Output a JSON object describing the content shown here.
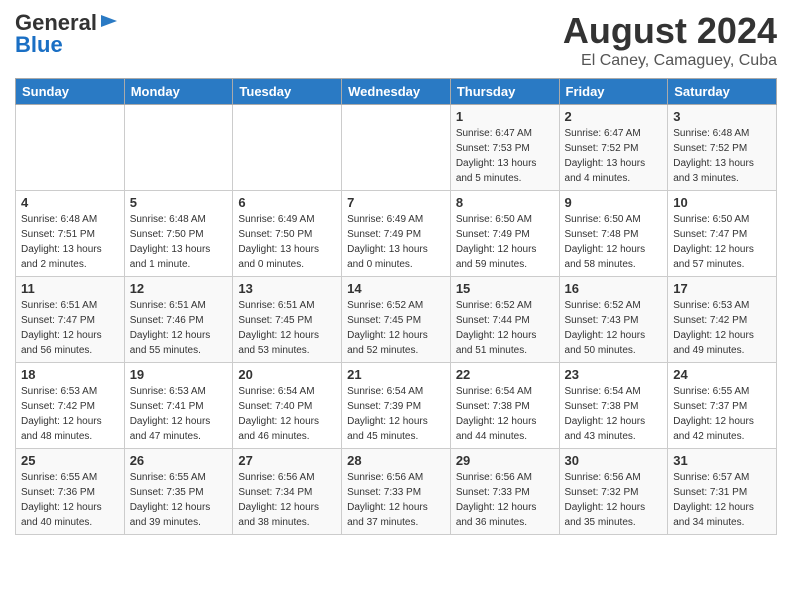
{
  "header": {
    "logo_line1": "General",
    "logo_line2": "Blue",
    "month_year": "August 2024",
    "location": "El Caney, Camaguey, Cuba"
  },
  "days_of_week": [
    "Sunday",
    "Monday",
    "Tuesday",
    "Wednesday",
    "Thursday",
    "Friday",
    "Saturday"
  ],
  "weeks": [
    [
      {
        "day": "",
        "sunrise": "",
        "sunset": "",
        "daylight": ""
      },
      {
        "day": "",
        "sunrise": "",
        "sunset": "",
        "daylight": ""
      },
      {
        "day": "",
        "sunrise": "",
        "sunset": "",
        "daylight": ""
      },
      {
        "day": "",
        "sunrise": "",
        "sunset": "",
        "daylight": ""
      },
      {
        "day": "1",
        "sunrise": "Sunrise: 6:47 AM",
        "sunset": "Sunset: 7:53 PM",
        "daylight": "Daylight: 13 hours and 5 minutes."
      },
      {
        "day": "2",
        "sunrise": "Sunrise: 6:47 AM",
        "sunset": "Sunset: 7:52 PM",
        "daylight": "Daylight: 13 hours and 4 minutes."
      },
      {
        "day": "3",
        "sunrise": "Sunrise: 6:48 AM",
        "sunset": "Sunset: 7:52 PM",
        "daylight": "Daylight: 13 hours and 3 minutes."
      }
    ],
    [
      {
        "day": "4",
        "sunrise": "Sunrise: 6:48 AM",
        "sunset": "Sunset: 7:51 PM",
        "daylight": "Daylight: 13 hours and 2 minutes."
      },
      {
        "day": "5",
        "sunrise": "Sunrise: 6:48 AM",
        "sunset": "Sunset: 7:50 PM",
        "daylight": "Daylight: 13 hours and 1 minute."
      },
      {
        "day": "6",
        "sunrise": "Sunrise: 6:49 AM",
        "sunset": "Sunset: 7:50 PM",
        "daylight": "Daylight: 13 hours and 0 minutes."
      },
      {
        "day": "7",
        "sunrise": "Sunrise: 6:49 AM",
        "sunset": "Sunset: 7:49 PM",
        "daylight": "Daylight: 13 hours and 0 minutes."
      },
      {
        "day": "8",
        "sunrise": "Sunrise: 6:50 AM",
        "sunset": "Sunset: 7:49 PM",
        "daylight": "Daylight: 12 hours and 59 minutes."
      },
      {
        "day": "9",
        "sunrise": "Sunrise: 6:50 AM",
        "sunset": "Sunset: 7:48 PM",
        "daylight": "Daylight: 12 hours and 58 minutes."
      },
      {
        "day": "10",
        "sunrise": "Sunrise: 6:50 AM",
        "sunset": "Sunset: 7:47 PM",
        "daylight": "Daylight: 12 hours and 57 minutes."
      }
    ],
    [
      {
        "day": "11",
        "sunrise": "Sunrise: 6:51 AM",
        "sunset": "Sunset: 7:47 PM",
        "daylight": "Daylight: 12 hours and 56 minutes."
      },
      {
        "day": "12",
        "sunrise": "Sunrise: 6:51 AM",
        "sunset": "Sunset: 7:46 PM",
        "daylight": "Daylight: 12 hours and 55 minutes."
      },
      {
        "day": "13",
        "sunrise": "Sunrise: 6:51 AM",
        "sunset": "Sunset: 7:45 PM",
        "daylight": "Daylight: 12 hours and 53 minutes."
      },
      {
        "day": "14",
        "sunrise": "Sunrise: 6:52 AM",
        "sunset": "Sunset: 7:45 PM",
        "daylight": "Daylight: 12 hours and 52 minutes."
      },
      {
        "day": "15",
        "sunrise": "Sunrise: 6:52 AM",
        "sunset": "Sunset: 7:44 PM",
        "daylight": "Daylight: 12 hours and 51 minutes."
      },
      {
        "day": "16",
        "sunrise": "Sunrise: 6:52 AM",
        "sunset": "Sunset: 7:43 PM",
        "daylight": "Daylight: 12 hours and 50 minutes."
      },
      {
        "day": "17",
        "sunrise": "Sunrise: 6:53 AM",
        "sunset": "Sunset: 7:42 PM",
        "daylight": "Daylight: 12 hours and 49 minutes."
      }
    ],
    [
      {
        "day": "18",
        "sunrise": "Sunrise: 6:53 AM",
        "sunset": "Sunset: 7:42 PM",
        "daylight": "Daylight: 12 hours and 48 minutes."
      },
      {
        "day": "19",
        "sunrise": "Sunrise: 6:53 AM",
        "sunset": "Sunset: 7:41 PM",
        "daylight": "Daylight: 12 hours and 47 minutes."
      },
      {
        "day": "20",
        "sunrise": "Sunrise: 6:54 AM",
        "sunset": "Sunset: 7:40 PM",
        "daylight": "Daylight: 12 hours and 46 minutes."
      },
      {
        "day": "21",
        "sunrise": "Sunrise: 6:54 AM",
        "sunset": "Sunset: 7:39 PM",
        "daylight": "Daylight: 12 hours and 45 minutes."
      },
      {
        "day": "22",
        "sunrise": "Sunrise: 6:54 AM",
        "sunset": "Sunset: 7:38 PM",
        "daylight": "Daylight: 12 hours and 44 minutes."
      },
      {
        "day": "23",
        "sunrise": "Sunrise: 6:54 AM",
        "sunset": "Sunset: 7:38 PM",
        "daylight": "Daylight: 12 hours and 43 minutes."
      },
      {
        "day": "24",
        "sunrise": "Sunrise: 6:55 AM",
        "sunset": "Sunset: 7:37 PM",
        "daylight": "Daylight: 12 hours and 42 minutes."
      }
    ],
    [
      {
        "day": "25",
        "sunrise": "Sunrise: 6:55 AM",
        "sunset": "Sunset: 7:36 PM",
        "daylight": "Daylight: 12 hours and 40 minutes."
      },
      {
        "day": "26",
        "sunrise": "Sunrise: 6:55 AM",
        "sunset": "Sunset: 7:35 PM",
        "daylight": "Daylight: 12 hours and 39 minutes."
      },
      {
        "day": "27",
        "sunrise": "Sunrise: 6:56 AM",
        "sunset": "Sunset: 7:34 PM",
        "daylight": "Daylight: 12 hours and 38 minutes."
      },
      {
        "day": "28",
        "sunrise": "Sunrise: 6:56 AM",
        "sunset": "Sunset: 7:33 PM",
        "daylight": "Daylight: 12 hours and 37 minutes."
      },
      {
        "day": "29",
        "sunrise": "Sunrise: 6:56 AM",
        "sunset": "Sunset: 7:33 PM",
        "daylight": "Daylight: 12 hours and 36 minutes."
      },
      {
        "day": "30",
        "sunrise": "Sunrise: 6:56 AM",
        "sunset": "Sunset: 7:32 PM",
        "daylight": "Daylight: 12 hours and 35 minutes."
      },
      {
        "day": "31",
        "sunrise": "Sunrise: 6:57 AM",
        "sunset": "Sunset: 7:31 PM",
        "daylight": "Daylight: 12 hours and 34 minutes."
      }
    ]
  ]
}
